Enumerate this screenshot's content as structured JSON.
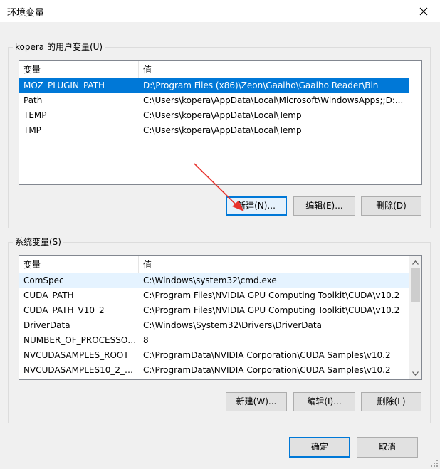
{
  "window": {
    "title": "环境变量"
  },
  "user_vars": {
    "group_title": "kopera 的用户变量(U)",
    "col_name": "变量",
    "col_value": "值",
    "rows": [
      {
        "name": "MOZ_PLUGIN_PATH",
        "value": "D:\\Program Files (x86)\\Zeon\\Gaaiho\\Gaaiho Reader\\Bin"
      },
      {
        "name": "Path",
        "value": "C:\\Users\\kopera\\AppData\\Local\\Microsoft\\WindowsApps;;D:..."
      },
      {
        "name": "TEMP",
        "value": "C:\\Users\\kopera\\AppData\\Local\\Temp"
      },
      {
        "name": "TMP",
        "value": "C:\\Users\\kopera\\AppData\\Local\\Temp"
      }
    ],
    "new_label": "新建(N)...",
    "edit_label": "编辑(E)...",
    "delete_label": "删除(D)"
  },
  "sys_vars": {
    "group_title": "系统变量(S)",
    "col_name": "变量",
    "col_value": "值",
    "rows": [
      {
        "name": "ComSpec",
        "value": "C:\\Windows\\system32\\cmd.exe"
      },
      {
        "name": "CUDA_PATH",
        "value": "C:\\Program Files\\NVIDIA GPU Computing Toolkit\\CUDA\\v10.2"
      },
      {
        "name": "CUDA_PATH_V10_2",
        "value": "C:\\Program Files\\NVIDIA GPU Computing Toolkit\\CUDA\\v10.2"
      },
      {
        "name": "DriverData",
        "value": "C:\\Windows\\System32\\Drivers\\DriverData"
      },
      {
        "name": "NUMBER_OF_PROCESSORS",
        "value": "8"
      },
      {
        "name": "NVCUDASAMPLES_ROOT",
        "value": "C:\\ProgramData\\NVIDIA Corporation\\CUDA Samples\\v10.2"
      },
      {
        "name": "NVCUDASAMPLES10_2_R...",
        "value": "C:\\ProgramData\\NVIDIA Corporation\\CUDA Samples\\v10.2"
      }
    ],
    "new_label": "新建(W)...",
    "edit_label": "编辑(I)...",
    "delete_label": "删除(L)"
  },
  "footer": {
    "ok_label": "确定",
    "cancel_label": "取消"
  },
  "colors": {
    "selection": "#0078d7",
    "annotation_arrow": "#e8322d"
  }
}
